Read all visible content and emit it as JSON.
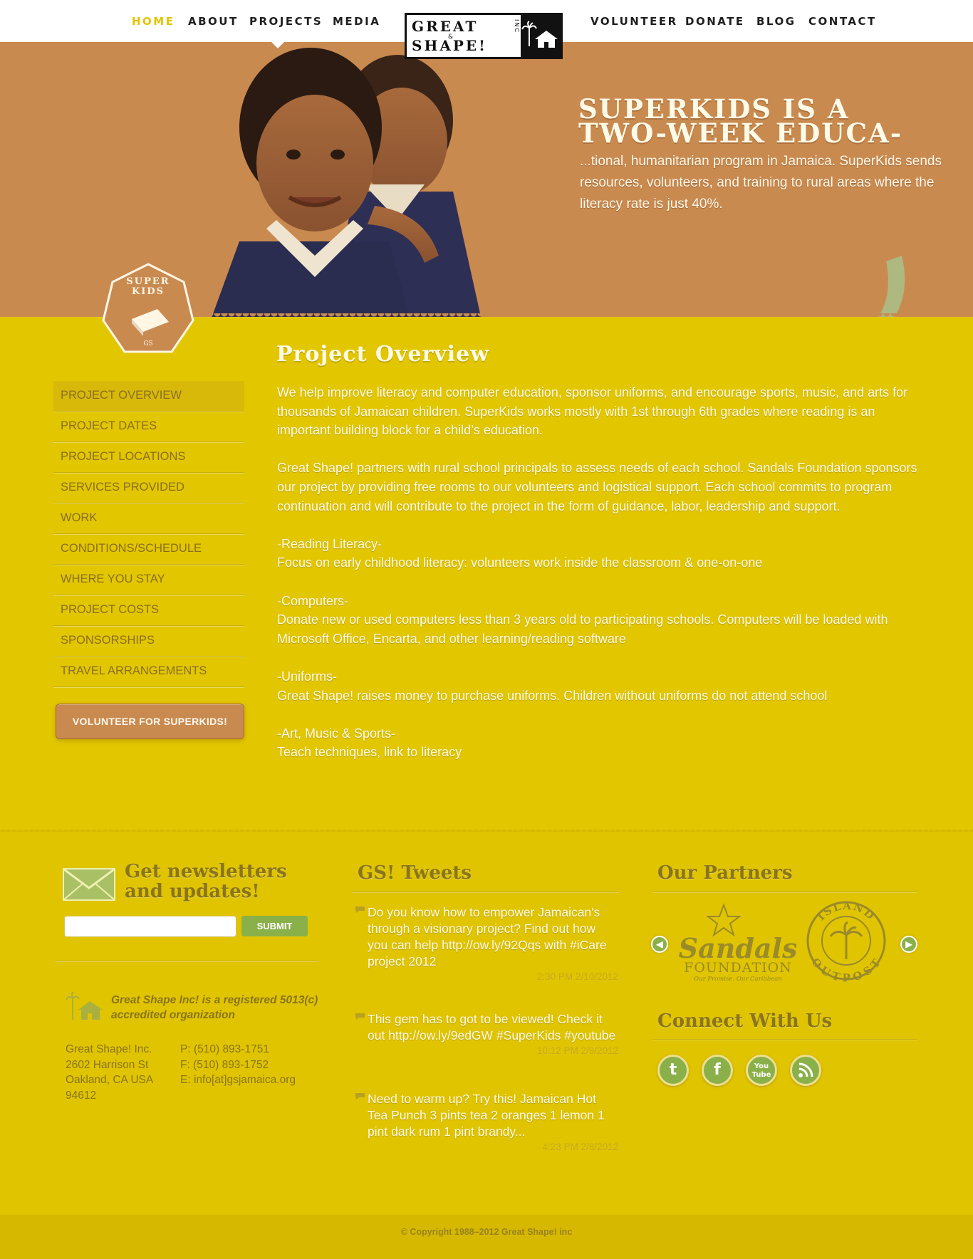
{
  "nav": {
    "left": [
      "HOME",
      "ABOUT",
      "PROJECTS",
      "MEDIA"
    ],
    "right": [
      "VOLUNTEER",
      "DONATE",
      "BLOG",
      "CONTACT"
    ],
    "active": "HOME"
  },
  "logo": {
    "line1": "GREAT",
    "line2": "SHAPE!",
    "amp": "&",
    "inc": "INC"
  },
  "hero": {
    "title_line1": "SUPERKIDS IS A",
    "title_line2": "TWO-WEEK EDUCA-",
    "text": "...tional, humanitarian program in Jamaica. SuperKids sends resources, volunteers, and training to rural areas where the literacy rate is just 40%."
  },
  "badge": {
    "line1": "SUPER",
    "line2": "KIDS"
  },
  "sidebar": {
    "items": [
      "PROJECT OVERVIEW",
      "PROJECT DATES",
      "PROJECT LOCATIONS",
      "SERVICES PROVIDED",
      "WORK",
      "CONDITIONS/SCHEDULE",
      "WHERE YOU STAY",
      "PROJECT COSTS",
      "SPONSORSHIPS",
      "TRAVEL ARRANGEMENTS"
    ],
    "volunteer_button": "VOLUNTEER FOR SUPERKIDS!"
  },
  "main": {
    "title": "Project Overview",
    "p1": "We help improve literacy and computer education, sponsor uniforms, and encourage sports, music, and arts for thousands of Jamaican children. SuperKids works mostly with 1st through 6th grades where reading is an important building block for a child’s education.",
    "p2": "Great Shape! partners with rural school principals to assess needs of each school. Sandals Foundation sponsors our project by providing free rooms to our volunteers and logistical support.  Each school commits to program continuation and will contribute to the project in the form of guidance, labor, leadership and support.",
    "sections": [
      {
        "heading": "-Reading Literacy-",
        "text": "Focus on early childhood literacy: volunteers work inside the classroom & one-on-one"
      },
      {
        "heading": "-Computers-",
        "text": "Donate new or used computers less than 3 years old to participating schools. Computers will be loaded with Microsoft Office, Encarta, and other learning/reading software"
      },
      {
        "heading": "-Uniforms-",
        "text": "Great Shape! raises money to purchase uniforms. Children without uniforms do not attend school"
      },
      {
        "heading": "-Art, Music & Sports-",
        "text": "Teach techniques, link to literacy"
      }
    ]
  },
  "newsletter": {
    "title_line1": "Get newsletters",
    "title_line2": "and updates!",
    "input_placeholder": "",
    "submit_label": "SUBMIT",
    "org_note": "Great Shape Inc! is a registered 5013(c) accredited organization",
    "address": [
      "Great Shape! Inc.",
      "2602 Harrison St",
      "Oakland, CA USA",
      "94612"
    ],
    "contacts": [
      "P: (510) 893-1751",
      "F: (510) 893-1752",
      "E: info[at]gsjamaica.org"
    ]
  },
  "tweets": {
    "title": "GS! Tweets",
    "items": [
      {
        "text": "Do you know how to empower Jamaican's through a visionary project? Find out how you can help http://ow.ly/92Qqs with #iCare project 2012",
        "time": "2:30 PM 2/10/2012"
      },
      {
        "text": "This gem has to got to be viewed! Check it out http://ow.ly/9edGW #SuperKids #youtube",
        "time": "10:12 PM 2/9/2012"
      },
      {
        "text": "Need to warm up? Try this! Jamaican Hot Tea Punch 3 pints tea 2 oranges 1 lemon 1 pint dark rum 1 pint brandy...",
        "time": "4:23 PM 2/8/2012"
      }
    ]
  },
  "partners": {
    "title": "Our Partners",
    "sandals_word": "Sandals",
    "sandals_sub": "FOUNDATION",
    "sandals_tag": "Our Promise. Our Caribbean",
    "outpost_top": "ISLAND",
    "outpost_bottom": "OUTPOST"
  },
  "connect": {
    "title": "Connect With Us",
    "icons": [
      "twitter-icon",
      "facebook-icon",
      "youtube-icon",
      "rss-icon"
    ]
  },
  "copyright": "© Copyright 1988–2012 Great Shape! inc",
  "colors": {
    "hero_orange": "#c98a50",
    "page_yellow": "#e2c600",
    "accent_green": "#8ab04a",
    "text_cream": "#fffbe8",
    "text_olive": "#8a741c"
  }
}
